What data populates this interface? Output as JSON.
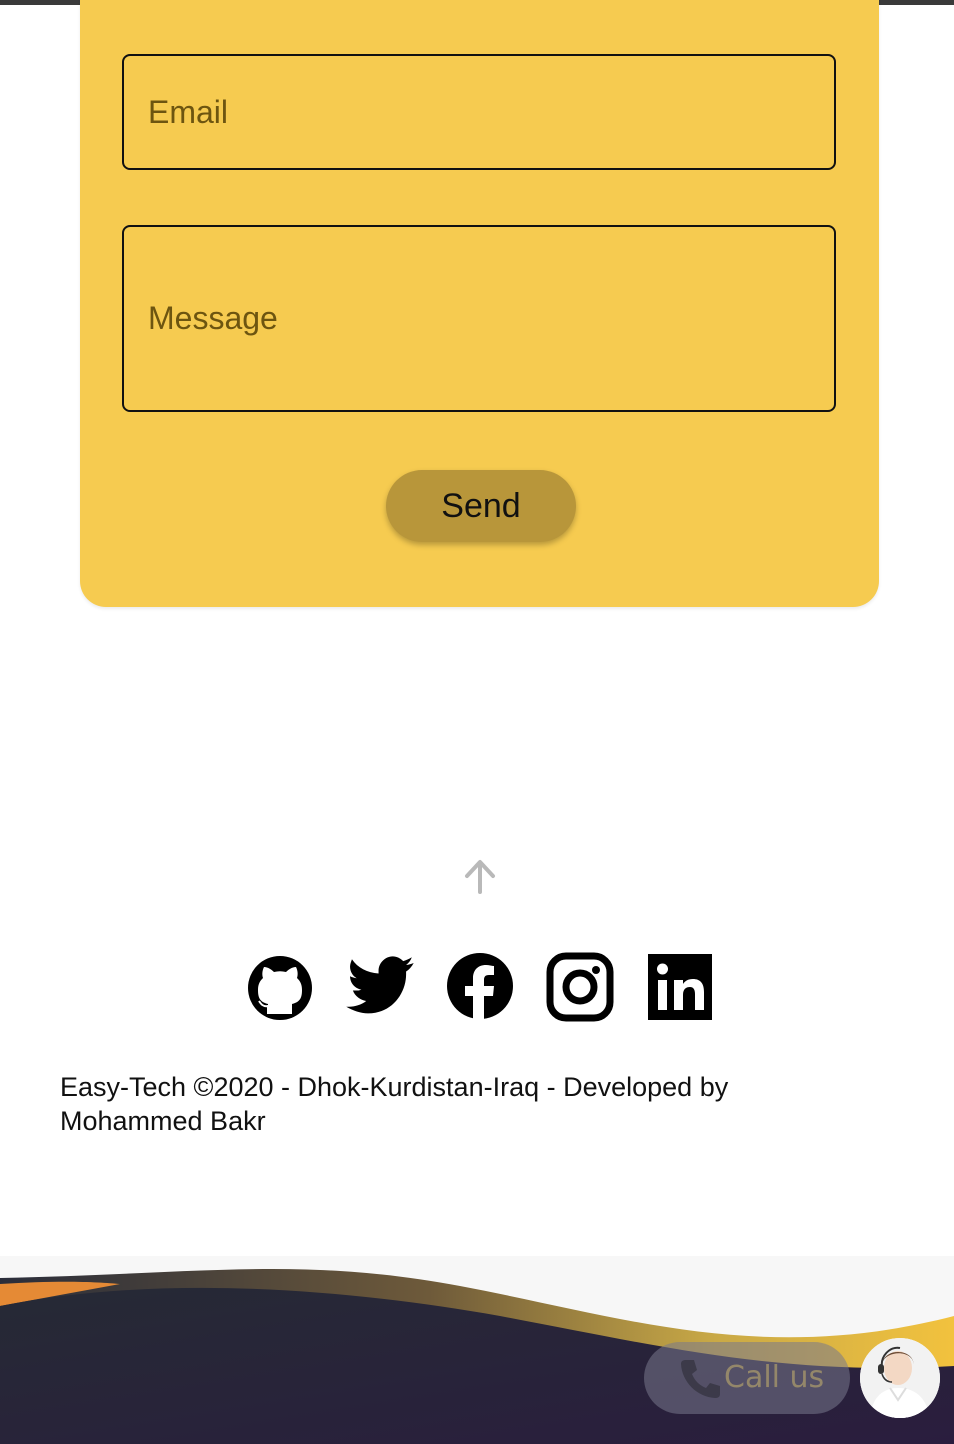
{
  "form": {
    "email_placeholder": "Email",
    "message_placeholder": "Message",
    "send_label": "Send",
    "accent_color": "#f6cb50",
    "button_color": "#b8963a"
  },
  "social": {
    "icons": [
      "github-icon",
      "twitter-icon",
      "facebook-icon",
      "instagram-icon",
      "linkedin-icon"
    ]
  },
  "footer": {
    "text": "Easy-Tech ©2020 - Dhok-Kurdistan-Iraq - Developed by Mohammed Bakr"
  },
  "call_widget": {
    "label": "Call us"
  }
}
